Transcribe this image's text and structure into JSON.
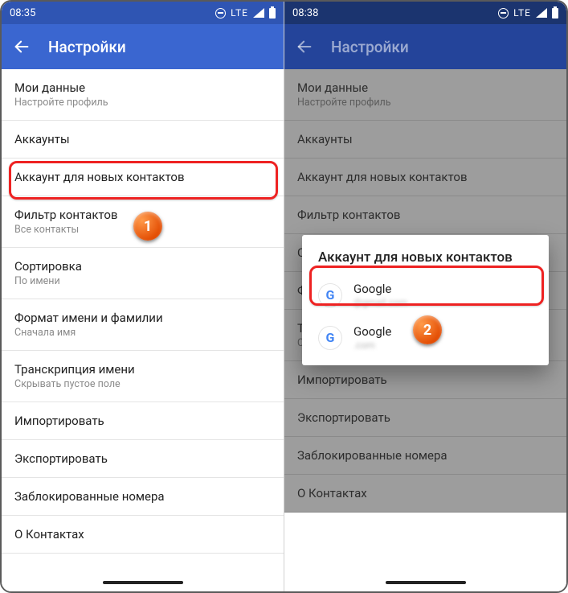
{
  "left": {
    "status_time": "08:35",
    "status_net": "LTE",
    "appbar_title": "Настройки",
    "rows": [
      {
        "primary": "Мои данные",
        "secondary": "Настройте профиль"
      },
      {
        "primary": "Аккаунты"
      },
      {
        "primary": "Аккаунт для новых контактов"
      },
      {
        "primary": "Фильтр контактов",
        "secondary": "Все контакты"
      },
      {
        "primary": "Сортировка",
        "secondary": "По имени"
      },
      {
        "primary": "Формат имени и фамилии",
        "secondary": "Сначала имя"
      },
      {
        "primary": "Транскрипция имени",
        "secondary": "Скрывать пустое поле"
      },
      {
        "primary": "Импортировать"
      },
      {
        "primary": "Экспортировать"
      },
      {
        "primary": "Заблокированные номера"
      },
      {
        "primary": "О Контактах"
      }
    ]
  },
  "right": {
    "status_time": "08:38",
    "status_net": "LTE",
    "appbar_title": "Настройки",
    "dialog_title": "Аккаунт для новых контактов",
    "accounts": [
      {
        "name": "Google",
        "email": "@gmail.com"
      },
      {
        "name": "Google",
        "email": ".com"
      }
    ]
  },
  "markers": {
    "one": "1",
    "two": "2"
  }
}
